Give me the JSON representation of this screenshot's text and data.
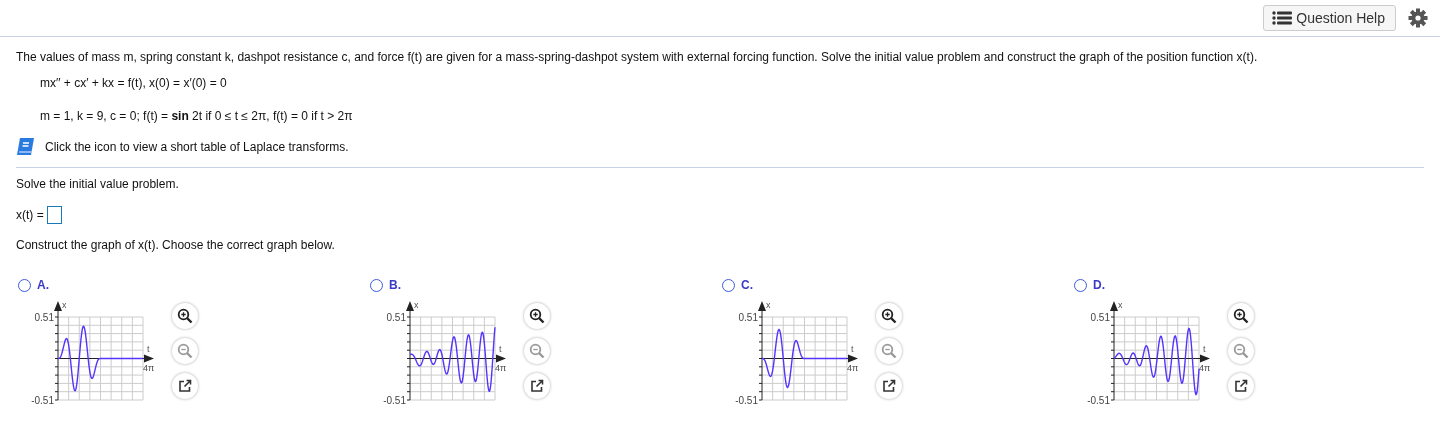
{
  "toolbar": {
    "help_button": "Question Help"
  },
  "problem": {
    "statement": "The values of mass m, spring constant k, dashpot resistance c, and force f(t) are given for a mass-spring-dashpot system with external forcing function. Solve the initial value problem and construct the graph of the position function x(t).",
    "equations": [
      "mx′′ + cx′ + kx = f(t), x(0) = x′(0) = 0",
      "m = 1, k = 9, c = 0; f(t) = **sin** 2t if 0 ≤ t ≤ 2π, f(t) = 0 if t > 2π"
    ],
    "laplace_link": "Click the icon to view a short table of Laplace transforms."
  },
  "part": {
    "prompt": "Solve the initial value problem.",
    "answer_label": "x(t) =",
    "graph_prompt": "Construct the graph of x(t). Choose the correct graph below."
  },
  "options": [
    {
      "letter": "A.",
      "selected": false,
      "kind": "pulse",
      "y_axis": "x",
      "x_axis": "t",
      "y_max": "0.51",
      "y_min": "-0.51",
      "x_end": "4π"
    },
    {
      "letter": "B.",
      "selected": false,
      "kind": "growing",
      "y_axis": "x",
      "x_axis": "t",
      "y_max": "0.51",
      "y_min": "-0.51",
      "x_end": "4π"
    },
    {
      "letter": "C.",
      "selected": false,
      "kind": "pulse-flipped",
      "y_axis": "x",
      "x_axis": "t",
      "y_max": "0.51",
      "y_min": "-0.51",
      "x_end": "4π"
    },
    {
      "letter": "D.",
      "selected": false,
      "kind": "growing-shifted",
      "y_axis": "x",
      "x_axis": "t",
      "y_max": "0.51",
      "y_min": "-0.51",
      "x_end": "4π"
    }
  ]
}
